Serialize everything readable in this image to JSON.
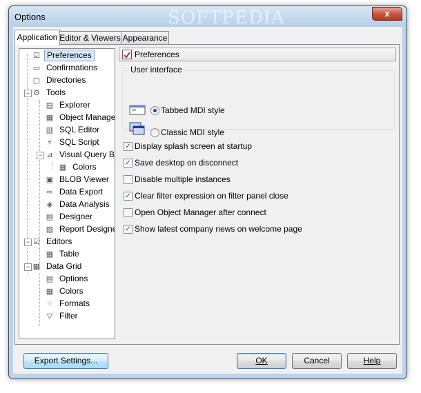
{
  "window": {
    "title": "Options",
    "watermark": "SOFTPEDIA",
    "close_glyph": "x"
  },
  "tabs": [
    {
      "label": "Application",
      "active": true
    },
    {
      "label": "Editor & Viewers",
      "active": false
    },
    {
      "label": "Appearance",
      "active": false
    }
  ],
  "tree": {
    "items": [
      {
        "label": "Preferences",
        "icon": "preferences-checkbox-icon",
        "selected": true
      },
      {
        "label": "Confirmations",
        "icon": "confirmations-icon"
      },
      {
        "label": "Directories",
        "icon": "folder-icon"
      },
      {
        "label": "Tools",
        "icon": "tools-gear-icon"
      },
      {
        "label": "Explorer",
        "icon": "explorer-icon"
      },
      {
        "label": "Object Manager",
        "icon": "object-manager-icon"
      },
      {
        "label": "SQL Editor",
        "icon": "sql-editor-icon"
      },
      {
        "label": "SQL Script",
        "icon": "sql-script-icon"
      },
      {
        "label": "Visual Query Builder",
        "icon": "visual-query-icon"
      },
      {
        "label": "Colors",
        "icon": "colors-grid-icon"
      },
      {
        "label": "BLOB Viewer",
        "icon": "blob-viewer-icon"
      },
      {
        "label": "Data Export",
        "icon": "data-export-icon"
      },
      {
        "label": "Data Analysis",
        "icon": "data-analysis-icon"
      },
      {
        "label": "Designer",
        "icon": "designer-icon"
      },
      {
        "label": "Report Designer",
        "icon": "report-designer-icon"
      },
      {
        "label": "Editors",
        "icon": "editors-check-icon"
      },
      {
        "label": "Table",
        "icon": "table-icon"
      },
      {
        "label": "Data Grid",
        "icon": "data-grid-icon"
      },
      {
        "label": "Options",
        "icon": "options-icon"
      },
      {
        "label": "Colors",
        "icon": "colors-grid-icon"
      },
      {
        "label": "Formats",
        "icon": "formats-icon"
      },
      {
        "label": "Filter",
        "icon": "filter-funnel-icon"
      }
    ]
  },
  "page": {
    "header": "Preferences",
    "user_interface": {
      "label": "User interface",
      "options": [
        {
          "label": "Tabbed MDI style",
          "checked": true
        },
        {
          "label": "Classic MDI style",
          "checked": false
        }
      ]
    },
    "checkboxes": [
      {
        "label": "Display splash screen at startup",
        "checked": true
      },
      {
        "label": "Save desktop on disconnect",
        "checked": true
      },
      {
        "label": "Disable multiple instances",
        "checked": false
      },
      {
        "label": "Clear filter expression on filter panel close",
        "checked": true
      },
      {
        "label": "Open Object Manager after connect",
        "checked": false
      },
      {
        "label": "Show latest company news on welcome page",
        "checked": true
      }
    ]
  },
  "buttons": {
    "export": "Export Settings...",
    "ok": "OK",
    "cancel": "Cancel",
    "help": "Help"
  }
}
